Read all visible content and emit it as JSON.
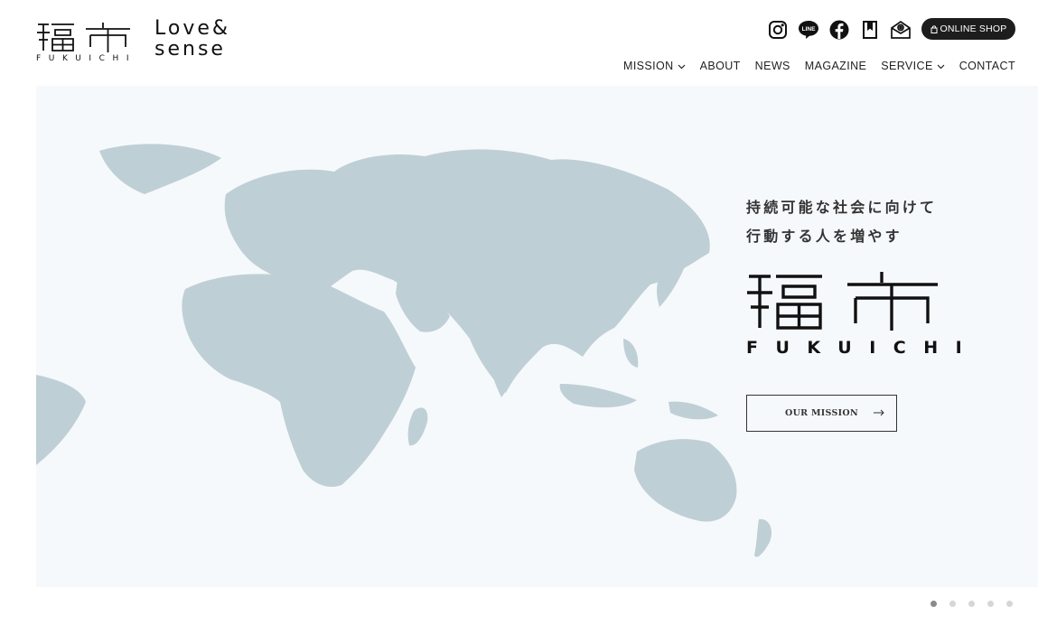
{
  "brand": {
    "logo_roman": "FUKUICHI",
    "love_line1": "Love&",
    "love_line2": "sense"
  },
  "header": {
    "social_icons": [
      "instagram-icon",
      "line-icon",
      "facebook-icon",
      "book-icon",
      "mail-icon"
    ],
    "line_icon_text": "LINE",
    "shop_label": "ONLINE SHOP"
  },
  "nav": {
    "items": [
      {
        "label": "MISSION",
        "has_dropdown": true
      },
      {
        "label": "ABOUT",
        "has_dropdown": false
      },
      {
        "label": "NEWS",
        "has_dropdown": false
      },
      {
        "label": "MAGAZINE",
        "has_dropdown": false
      },
      {
        "label": "SERVICE",
        "has_dropdown": true
      },
      {
        "label": "CONTACT",
        "has_dropdown": false
      }
    ]
  },
  "hero": {
    "tagline_line1": "持続可能な社会に向けて",
    "tagline_line2": "行動する人を増やす",
    "logo_roman": "FUKUICHI",
    "mission_button": "OUR MISSION",
    "map_color": "#bfcfd6",
    "background_color": "#f6f9fc"
  },
  "slider": {
    "total": 5,
    "active_index": 0
  }
}
